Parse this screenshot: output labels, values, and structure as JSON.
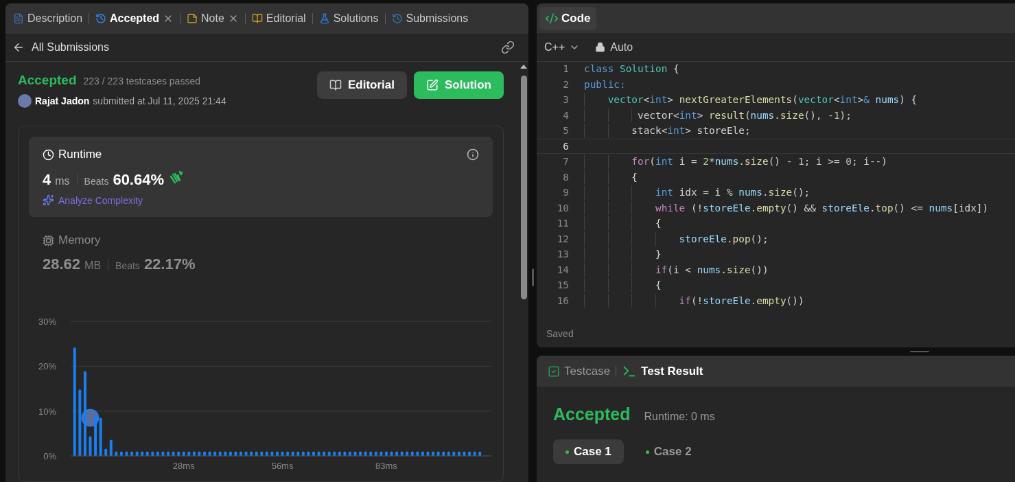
{
  "tabs": [
    {
      "label": "Description",
      "kind": "description",
      "selected": false,
      "closable": false
    },
    {
      "label": "Accepted",
      "kind": "accepted",
      "selected": true,
      "closable": true
    },
    {
      "label": "Note",
      "kind": "note",
      "selected": false,
      "closable": true
    },
    {
      "label": "Editorial",
      "kind": "editorial",
      "selected": false,
      "closable": false
    },
    {
      "label": "Solutions",
      "kind": "solutions",
      "selected": false,
      "closable": false
    },
    {
      "label": "Submissions",
      "kind": "submissions",
      "selected": false,
      "closable": false
    }
  ],
  "submission": {
    "back_label": "All Submissions",
    "status": "Accepted",
    "testcases": "223 / 223 testcases passed",
    "author": "Rajat Jadon",
    "submitted": "submitted at Jul 11, 2025 21:44",
    "buttons": [
      {
        "label": "Editorial",
        "kind": "editorial"
      },
      {
        "label": "Solution",
        "kind": "solution"
      }
    ],
    "metrics": [
      {
        "kind": "runtime",
        "title": "Runtime",
        "value": "4",
        "unit": "ms",
        "beats_label": "Beats",
        "beats": "60.64%",
        "selected": true,
        "link": "Analyze Complexity"
      },
      {
        "kind": "memory",
        "title": "Memory",
        "value": "28.62",
        "unit": "MB",
        "beats_label": "Beats",
        "beats": "22.17%",
        "selected": false
      }
    ],
    "distribution": {
      "chart_data": {
        "type": "bar",
        "ylim": [
          0,
          30
        ],
        "yticks": [
          {
            "value": 0,
            "label": "0%"
          },
          {
            "value": 10,
            "label": "10%"
          },
          {
            "value": 20,
            "label": "20%"
          },
          {
            "value": 30,
            "label": "30%"
          }
        ],
        "categories": [
          null,
          null,
          null,
          null,
          null,
          null,
          null,
          null,
          null,
          null,
          null,
          null,
          null,
          null,
          null,
          null,
          null,
          null,
          null,
          null,
          null,
          "28ms",
          null,
          null,
          null,
          null,
          null,
          null,
          null,
          null,
          null,
          null,
          null,
          null,
          null,
          null,
          null,
          null,
          null,
          null,
          "56ms",
          null,
          null,
          null,
          null,
          null,
          null,
          null,
          null,
          null,
          null,
          null,
          null,
          null,
          null,
          null,
          null,
          null,
          null,
          null,
          "83ms",
          null,
          null,
          null,
          null,
          null,
          null,
          null,
          null,
          null,
          null,
          null,
          null,
          null,
          null,
          null,
          null,
          null,
          null
        ],
        "series": [
          {
            "color": "#1b7ef0",
            "values": [
              24.2,
              14.8,
              18.9,
              4.4,
              9,
              8.5,
              1.6,
              3.6,
              1,
              1,
              1,
              1,
              1,
              1,
              1,
              1,
              1,
              1,
              1,
              1,
              1,
              1,
              1,
              1,
              1,
              1,
              1,
              1,
              1,
              1,
              1,
              1,
              1,
              1,
              1,
              1,
              1,
              1,
              1,
              1,
              1,
              1,
              1,
              1,
              1,
              1,
              1,
              1,
              1,
              1,
              1,
              1,
              1,
              1,
              1,
              1,
              1,
              1,
              1,
              1,
              1,
              1,
              1,
              1,
              1,
              1,
              1,
              1,
              1,
              1,
              1,
              1,
              1,
              1,
              1,
              1,
              1,
              1,
              1
            ]
          }
        ]
      }
    }
  },
  "editor": {
    "tab": "Code",
    "language": "C++",
    "mode": "Auto",
    "status": "Saved",
    "lines": [
      {
        "number": "1",
        "active": false,
        "tokens": [
          {
            "kind": "kw",
            "text": "class"
          },
          {
            "kind": "type",
            "text": " Solution"
          },
          {
            "kind": "p",
            "text": " {"
          }
        ]
      },
      {
        "number": "2",
        "active": false,
        "tokens": [
          {
            "kind": "kw",
            "text": "public:"
          }
        ]
      },
      {
        "number": "3",
        "active": false,
        "tokens": [
          {
            "kind": "type",
            "text": "    vector"
          },
          {
            "kind": "p",
            "text": "<"
          },
          {
            "kind": "kw",
            "text": "int"
          },
          {
            "kind": "p",
            "text": "> "
          },
          {
            "kind": "fn",
            "text": "nextGreaterElements"
          },
          {
            "kind": "p",
            "text": "("
          },
          {
            "kind": "type",
            "text": "vector"
          },
          {
            "kind": "p",
            "text": "<"
          },
          {
            "kind": "kw",
            "text": "int"
          },
          {
            "kind": "p",
            "text": ">"
          },
          {
            "kind": "kw",
            "text": "&"
          },
          {
            "kind": "var",
            "text": " nums"
          },
          {
            "kind": "p",
            "text": ") {"
          }
        ]
      },
      {
        "number": "4",
        "active": false,
        "tokens": [
          {
            "kind": "p",
            "text": "         vector<"
          },
          {
            "kind": "kw",
            "text": "int"
          },
          {
            "kind": "p",
            "text": "> "
          },
          {
            "kind": "fn",
            "text": "result"
          },
          {
            "kind": "p",
            "text": "("
          },
          {
            "kind": "var",
            "text": "nums"
          },
          {
            "kind": "p",
            "text": "."
          },
          {
            "kind": "fn",
            "text": "size"
          },
          {
            "kind": "p",
            "text": "(), "
          },
          {
            "kind": "num",
            "text": "-1"
          },
          {
            "kind": "p",
            "text": ");"
          }
        ]
      },
      {
        "number": "5",
        "active": false,
        "tokens": [
          {
            "kind": "p",
            "text": "        stack<"
          },
          {
            "kind": "kw",
            "text": "int"
          },
          {
            "kind": "p",
            "text": "> storeEle;"
          }
        ]
      },
      {
        "number": "6",
        "active": true
      },
      {
        "number": "7",
        "active": false,
        "tokens": [
          {
            "kind": "ctl",
            "text": "        for"
          },
          {
            "kind": "p",
            "text": "("
          },
          {
            "kind": "kw",
            "text": "int"
          },
          {
            "kind": "p",
            "text": " i = "
          },
          {
            "kind": "num",
            "text": "2"
          },
          {
            "kind": "p",
            "text": "*"
          },
          {
            "kind": "var",
            "text": "nums"
          },
          {
            "kind": "p",
            "text": "."
          },
          {
            "kind": "fn",
            "text": "size"
          },
          {
            "kind": "p",
            "text": "() - "
          },
          {
            "kind": "num",
            "text": "1"
          },
          {
            "kind": "p",
            "text": "; i >= "
          },
          {
            "kind": "num",
            "text": "0"
          },
          {
            "kind": "p",
            "text": "; i--)"
          }
        ]
      },
      {
        "number": "8",
        "active": false,
        "tokens": [
          {
            "kind": "p",
            "text": "        {"
          }
        ]
      },
      {
        "number": "9",
        "active": false,
        "tokens": [
          {
            "kind": "kw",
            "text": "            int"
          },
          {
            "kind": "p",
            "text": " idx = i % "
          },
          {
            "kind": "var",
            "text": "nums"
          },
          {
            "kind": "p",
            "text": "."
          },
          {
            "kind": "fn",
            "text": "size"
          },
          {
            "kind": "p",
            "text": "();"
          }
        ]
      },
      {
        "number": "10",
        "active": false,
        "tokens": [
          {
            "kind": "ctl",
            "text": "            while"
          },
          {
            "kind": "p",
            "text": " (!"
          },
          {
            "kind": "var",
            "text": "storeEle"
          },
          {
            "kind": "p",
            "text": "."
          },
          {
            "kind": "fn",
            "text": "empty"
          },
          {
            "kind": "p",
            "text": "() && "
          },
          {
            "kind": "var",
            "text": "storeEle"
          },
          {
            "kind": "p",
            "text": "."
          },
          {
            "kind": "fn",
            "text": "top"
          },
          {
            "kind": "p",
            "text": "() <= "
          },
          {
            "kind": "var",
            "text": "nums"
          },
          {
            "kind": "p",
            "text": "[idx])"
          }
        ]
      },
      {
        "number": "11",
        "active": false,
        "tokens": [
          {
            "kind": "p",
            "text": "            {"
          }
        ]
      },
      {
        "number": "12",
        "active": false,
        "tokens": [
          {
            "kind": "var",
            "text": "                storeEle"
          },
          {
            "kind": "p",
            "text": "."
          },
          {
            "kind": "fn",
            "text": "pop"
          },
          {
            "kind": "p",
            "text": "();"
          }
        ]
      },
      {
        "number": "13",
        "active": false,
        "tokens": [
          {
            "kind": "p",
            "text": "            }"
          }
        ]
      },
      {
        "number": "14",
        "active": false,
        "tokens": [
          {
            "kind": "ctl",
            "text": "            if"
          },
          {
            "kind": "p",
            "text": "(i < "
          },
          {
            "kind": "var",
            "text": "nums"
          },
          {
            "kind": "p",
            "text": "."
          },
          {
            "kind": "fn",
            "text": "size"
          },
          {
            "kind": "p",
            "text": "())"
          }
        ]
      },
      {
        "number": "15",
        "active": false,
        "tokens": [
          {
            "kind": "p",
            "text": "            {"
          }
        ]
      },
      {
        "number": "16",
        "active": false,
        "tokens": [
          {
            "kind": "ctl",
            "text": "                if"
          },
          {
            "kind": "p",
            "text": "(!"
          },
          {
            "kind": "var",
            "text": "storeEle"
          },
          {
            "kind": "p",
            "text": "."
          },
          {
            "kind": "fn",
            "text": "empty"
          },
          {
            "kind": "p",
            "text": "())"
          }
        ]
      }
    ]
  },
  "console": {
    "tabs": [
      {
        "label": "Testcase",
        "kind": "testcase",
        "selected": false
      },
      {
        "label": "Test Result",
        "kind": "result",
        "selected": true
      }
    ],
    "status": "Accepted",
    "runtime": "Runtime: 0 ms",
    "cases": [
      {
        "label": "Case 1",
        "selected": true
      },
      {
        "label": "Case 2",
        "selected": false
      }
    ]
  }
}
